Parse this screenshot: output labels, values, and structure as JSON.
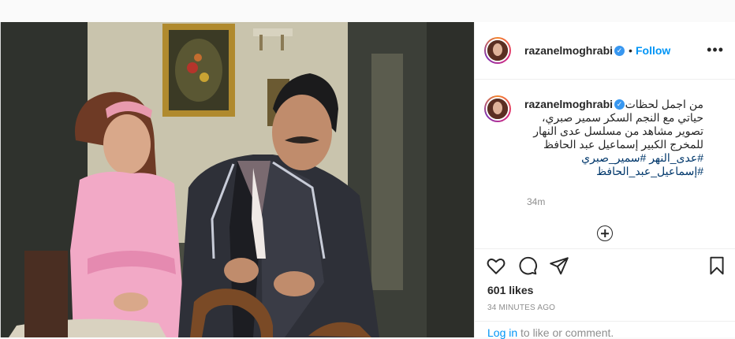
{
  "header": {
    "username": "razanelmoghrabi",
    "verified_icon": "verified-badge-icon",
    "separator": "•",
    "follow_label": "Follow",
    "more_icon": "more-options-icon",
    "more_glyph": "•••"
  },
  "caption": {
    "username": "razanelmoghrabi",
    "lines": [
      "من اجمل لحظات",
      "حياتي مع النجم السكر سمير صبري،",
      "تصوير مشاهد من مسلسل عدى النهار",
      "للمخرج الكبير إسماعيل عبد الحافظ"
    ],
    "hashtag_lines": [
      "#عدى_النهر #سمير_صبري",
      "#إسماعيل_عبد_الحافظ"
    ],
    "time": "34m"
  },
  "actions": {
    "like_icon": "heart-icon",
    "comment_icon": "comment-icon",
    "share_icon": "share-icon",
    "save_icon": "bookmark-icon",
    "likes": "601 likes",
    "time_ago": "34 MINUTES AGO"
  },
  "login": {
    "link_label": "Log in",
    "rest_label": "to like or comment."
  },
  "colors": {
    "accent": "#0095f6",
    "text": "#262626",
    "muted": "#8e8e8e",
    "verified": "#3897f0"
  }
}
